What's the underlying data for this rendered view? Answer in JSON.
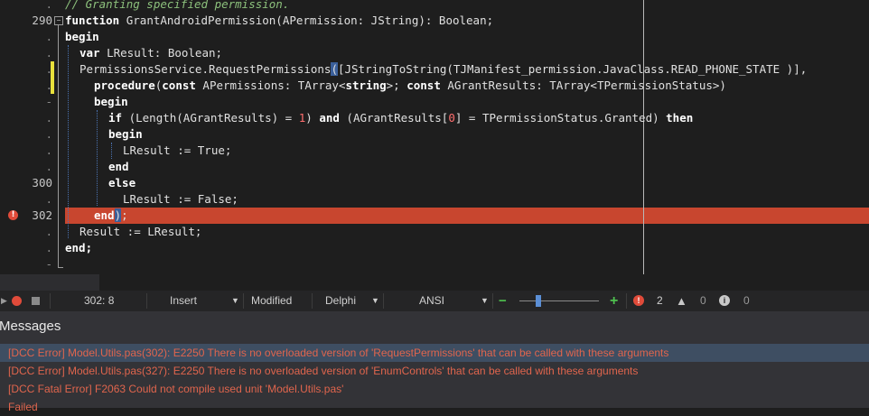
{
  "gutter": {
    "line_numbers": [
      ".",
      "290",
      ".",
      ".",
      ".",
      ".",
      "-",
      ".",
      ".",
      ".",
      ".",
      "300",
      ".",
      "302",
      ".",
      ".",
      "-"
    ],
    "error_marker": "!"
  },
  "code": {
    "comment": "// Granting specified permission.",
    "fn_kw": "function",
    "fn_sig": " GrantAndroidPermission(APermission: JString): Boolean;",
    "begin1": "begin",
    "var_kw": "var",
    "var_decl": " LResult: Boolean;",
    "req_a": "PermissionsService.RequestPermissions",
    "req_paren": "(",
    "req_b": "[JStringToString(TJManifest_permission.JavaClass.READ_PHONE_STATE )],",
    "proc_kw": "procedure",
    "proc_a": "(",
    "const1": "const",
    "proc_b": " APermissions: TArray<",
    "string_kw": "string",
    "proc_c": ">; ",
    "const2": "const",
    "proc_d": " AGrantResults: TArray<TPermissionStatus>)",
    "begin2": "begin",
    "if_kw": "if",
    "if_a": " (Length(AGrantResults) = ",
    "if_num1": "1",
    "if_b": ") ",
    "and_kw": "and",
    "if_c": " (AGrantResults[",
    "if_num0": "0",
    "if_d": "] = TPermissionStatus.Granted) ",
    "then_kw": "then",
    "begin3": "begin",
    "assign_true": "LResult := True;",
    "end1": "end",
    "else_kw": "else",
    "assign_false": "LResult := False;",
    "end2": "end",
    "end2_paren": ")",
    "end2_semi": ";",
    "result_line": "Result := LResult;",
    "end_final": "end;"
  },
  "statusbar": {
    "position": "302:  8",
    "insert_mode": "Insert",
    "modified": "Modified",
    "language": "Delphi",
    "encoding": "ANSI",
    "zoom_level": 0.1,
    "errors": "2",
    "warnings": "0",
    "hints": "0"
  },
  "messages": {
    "title": "Messages",
    "items": [
      "[DCC Error] Model.Utils.pas(302): E2250 There is no overloaded version of 'RequestPermissions' that can be called with these arguments",
      "[DCC Error] Model.Utils.pas(327): E2250 There is no overloaded version of 'EnumControls' that can be called with these arguments",
      "[DCC Fatal Error] F2063 Could not compile used unit 'Model.Utils.pas'",
      "Failed"
    ]
  },
  "colors": {
    "editor_bg": "#1e1e1e",
    "error_line": "#c8462f",
    "error_text": "#e0654d",
    "comment": "#8cc07c",
    "number": "#ff6f6f"
  }
}
